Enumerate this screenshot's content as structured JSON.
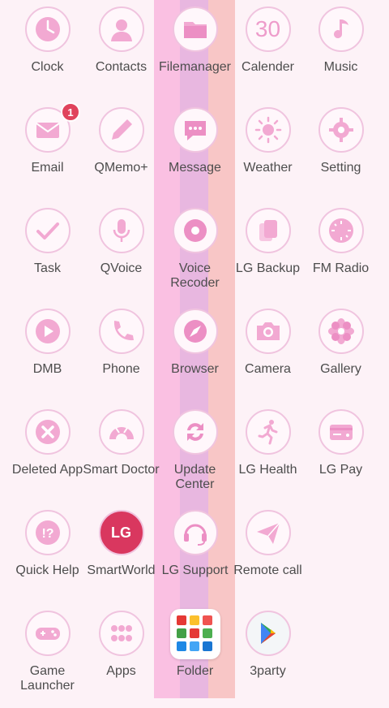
{
  "apps": [
    {
      "label": "Clock",
      "icon": "clock-icon"
    },
    {
      "label": "Contacts",
      "icon": "contacts-icon"
    },
    {
      "label": "Filemanager",
      "icon": "folder-icon"
    },
    {
      "label": "Calender",
      "icon": "calendar-icon",
      "icon_text": "30"
    },
    {
      "label": "Music",
      "icon": "music-note-icon"
    },
    {
      "label": "Email",
      "icon": "envelope-icon",
      "badge": "1"
    },
    {
      "label": "QMemo+",
      "icon": "pencil-icon"
    },
    {
      "label": "Message",
      "icon": "chat-bubble-icon"
    },
    {
      "label": "Weather",
      "icon": "sun-icon"
    },
    {
      "label": "Setting",
      "icon": "gear-icon"
    },
    {
      "label": "Task",
      "icon": "check-icon"
    },
    {
      "label": "QVoice",
      "icon": "microphone-icon"
    },
    {
      "label": "Voice Recoder",
      "icon": "record-icon"
    },
    {
      "label": "LG Backup",
      "icon": "backup-cards-icon"
    },
    {
      "label": "FM Radio",
      "icon": "radio-dial-icon"
    },
    {
      "label": "DMB",
      "icon": "play-icon"
    },
    {
      "label": "Phone",
      "icon": "phone-icon"
    },
    {
      "label": "Browser",
      "icon": "compass-icon"
    },
    {
      "label": "Camera",
      "icon": "camera-icon"
    },
    {
      "label": "Gallery",
      "icon": "flower-icon"
    },
    {
      "label": "Deleted App",
      "icon": "close-circle-icon"
    },
    {
      "label": "Smart Doctor",
      "icon": "gauge-icon"
    },
    {
      "label": "Update Center",
      "icon": "refresh-icon"
    },
    {
      "label": "LG Health",
      "icon": "runner-icon"
    },
    {
      "label": "LG Pay",
      "icon": "credit-card-icon"
    },
    {
      "label": "Quick Help",
      "icon": "help-bubble-icon"
    },
    {
      "label": "SmartWorld",
      "icon": "lg-logo-icon",
      "icon_text": "LG"
    },
    {
      "label": "LG Support",
      "icon": "headset-icon"
    },
    {
      "label": "Remote call",
      "icon": "paper-plane-icon"
    },
    {
      "label": "",
      "icon": ""
    },
    {
      "label": "Game Launcher",
      "icon": "gamepad-icon"
    },
    {
      "label": "Apps",
      "icon": "dots-grid-icon"
    },
    {
      "label": "Folder",
      "icon": "folder-preview-icon"
    },
    {
      "label": "3party",
      "icon": "play-store-icon"
    }
  ],
  "colors": {
    "accent": "#f0a8d4",
    "badge": "#e0435c",
    "stripe_pink": "#fac0e2",
    "stripe_lilac": "#e8b7e0",
    "stripe_peach": "#f8c6c6"
  }
}
